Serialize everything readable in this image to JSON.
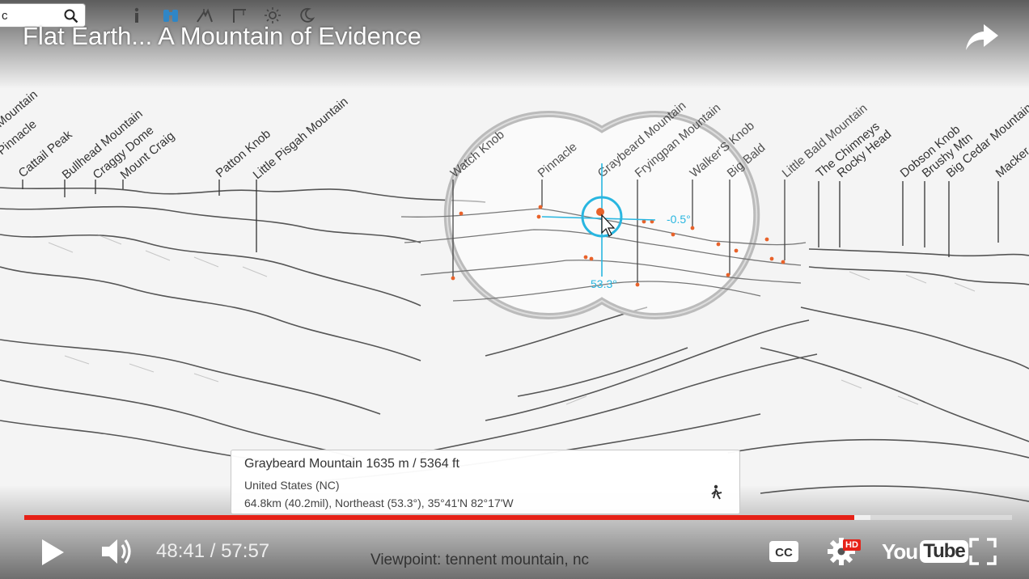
{
  "search": {
    "value": "c"
  },
  "toolbar_icons": [
    "info-icon",
    "binoculars-icon",
    "mountain-view-icon",
    "crane-icon",
    "sun-icon",
    "moon-icon"
  ],
  "video": {
    "title": "Flat Earth... A Mountain of Evidence",
    "time_current": "48:41",
    "time_separator": "/",
    "time_total": "57:57",
    "progress_fraction": 0.84,
    "buffered_fraction": 0.857
  },
  "peak_labels": {
    "left": [
      "Mountain",
      "Pinnacle",
      "Cattail Peak",
      "Bullhead Mountain",
      "Craggy Dome",
      "Mount Craig",
      "Patton Knob",
      "Little Pisgah Mountain"
    ],
    "lens": [
      "Watch Knob",
      "Pinnacle",
      "Graybeard Mountain",
      "Fryingpan Mountain",
      "Walker'S Knob",
      "Big Bald",
      "Little Bald Mountain"
    ],
    "right": [
      "The Chimneys",
      "Rocky Head",
      "Dobson Knob",
      "Brushy Mtn",
      "Big Cedar Mountain",
      "Macker"
    ]
  },
  "lens_readout": {
    "elevation_angle": "-0.5°",
    "azimuth": "53.3°"
  },
  "info_card": {
    "name": "Graybeard Mountain",
    "height": "1635 m / 5364 ft",
    "country": "United States (NC)",
    "details": "64.8km (40.2mil), Northeast (53.3°), 35°41'N 82°17'W"
  },
  "viewpoint": "Viewpoint: tennent mountain, nc",
  "controls": {
    "hd_badge": "HD",
    "logo_you": "You",
    "logo_tube": "Tube"
  },
  "colors": {
    "progress": "#e62117",
    "crosshair": "#29b6e0",
    "marker": "#e8622a"
  }
}
